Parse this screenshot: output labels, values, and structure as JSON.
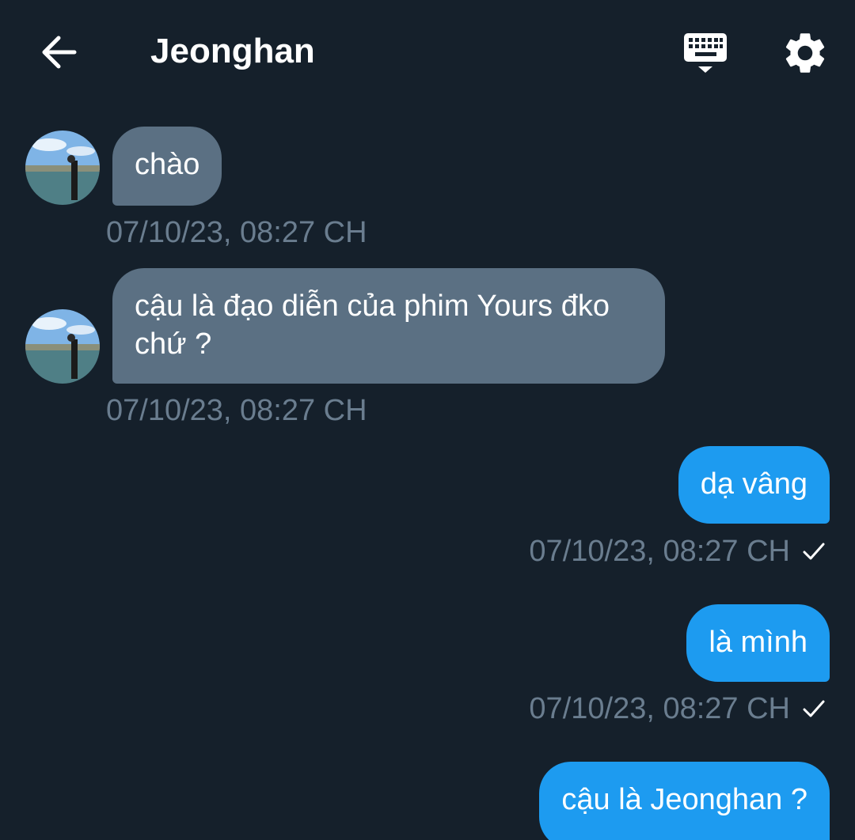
{
  "header": {
    "title": "Jeonghan",
    "back_icon": "arrow-left-icon",
    "keyboard_icon": "keyboard-icon",
    "settings_icon": "gear-icon"
  },
  "messages": [
    {
      "direction": "incoming",
      "text": "chào",
      "timestamp": "07/10/23, 08:27 CH"
    },
    {
      "direction": "incoming",
      "text": "cậu là đạo diễn của phim Yours đko chứ ?",
      "timestamp": "07/10/23, 08:27 CH"
    },
    {
      "direction": "outgoing",
      "text": "dạ vâng",
      "timestamp": "07/10/23, 08:27 CH",
      "status": "sent"
    },
    {
      "direction": "outgoing",
      "text": "là mình",
      "timestamp": "07/10/23, 08:27 CH",
      "status": "sent"
    },
    {
      "direction": "outgoing",
      "text": "cậu là Jeonghan ?",
      "timestamp": "",
      "status": ""
    }
  ],
  "colors": {
    "background": "#15202b",
    "incoming_bubble": "#5b7083",
    "outgoing_bubble": "#1d9bf0",
    "timestamp": "#6a7d8f",
    "text": "#ffffff"
  }
}
